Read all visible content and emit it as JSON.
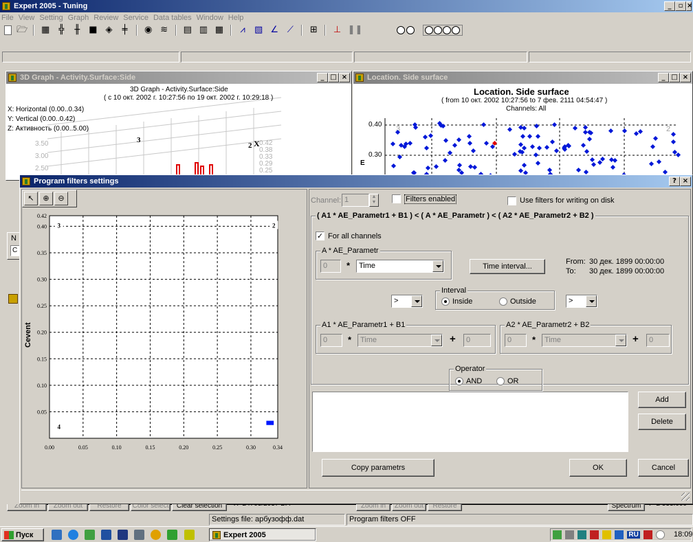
{
  "app": {
    "title": "Expert 2005 - Tuning",
    "menu": [
      "File",
      "View",
      "Setting",
      "Graph",
      "Review",
      "Service",
      "Data tables",
      "Window",
      "Help"
    ],
    "toolbar_circles_small": 2,
    "toolbar_circles_big": 4
  },
  "graph3d": {
    "title": "3D Graph - Activity.Surface:Side",
    "chart_title": "3D Graph - Activity.Surface:Side",
    "period": "( с 10 окт. 2002 г. 10:27:56  по 19 окт. 2002 г.  10:29:18 )",
    "axes": [
      "X: Horizontal (0.00..0.34)",
      "Y: Vertical (0.00..0.42)",
      "Z: Активность (0.00..5.00)"
    ],
    "ticks": [
      "3.50",
      "3.00",
      "2.50"
    ],
    "labels": [
      "3",
      "2",
      "X"
    ],
    "right_ticks": [
      "0.42",
      "0.38",
      "0.33",
      "0.29",
      "0.25"
    ],
    "bottom_left_tab": "N",
    "bottom_left_tab2": "C"
  },
  "location": {
    "title": "Location. Side surface",
    "chart_title": "Location. Side surface",
    "period": "( from 10 окт. 2002  10:27:56  to  7 фев. 2111  04:54:47 )",
    "channels": "Channels: All",
    "yticks": [
      "0.40",
      "0.30"
    ],
    "marker_labels": [
      "3",
      "2"
    ],
    "ylabel_frag": "E"
  },
  "dialog": {
    "title": "Program filters settings",
    "help_btn": "?",
    "close_btn": "×",
    "channel_label": "Channel:",
    "channel_value": "1",
    "filters_enabled": "Filters enabled",
    "use_filters_disk": "Use filters for writing on disk",
    "formula": "( A1 * AE_Parametr1 + B1 )  <  ( A * AE_Parametr )  <  ( A2 * AE_Parametr2 + B2 )",
    "for_all_channels": "For all channels",
    "a_group": "A * AE_Parametr",
    "a_value": "0",
    "a_param": "Time",
    "time_interval_btn": "Time interval...",
    "from_label": "From:",
    "from_value": "30 дек. 1899  00:00:00",
    "to_label": "To:",
    "to_value": "30 дек. 1899  00:00:00",
    "left_cmp": ">",
    "right_cmp": ">",
    "interval_group": "Interval",
    "inside": "Inside",
    "outside": "Outside",
    "a1_group": "A1 * AE_Parametr1 + B1",
    "a1_value": "0",
    "a1_param": "Time",
    "b1_value": "0",
    "a2_group": "A2 * AE_Parametr2 + B2",
    "a2_value": "0",
    "a2_param": "Time",
    "b2_value": "0",
    "operator_group": "Operator",
    "and": "AND",
    "or": "OR",
    "add_btn": "Add",
    "delete_btn": "Delete",
    "copy_btn": "Copy parametrs",
    "ok_btn": "OK",
    "cancel_btn": "Cancel",
    "star": "*",
    "plus": "+"
  },
  "chart_data": {
    "type": "scatter",
    "title": "",
    "xlabel": "",
    "ylabel": "Cevent",
    "x_ticks": [
      "0.00",
      "0.05",
      "0.10",
      "0.15",
      "0.20",
      "0.25",
      "0.30",
      "0.34"
    ],
    "y_ticks": [
      "0.42",
      "0.40",
      "0.35",
      "0.30",
      "0.25",
      "0.20",
      "0.15",
      "0.10",
      "0.05"
    ],
    "xlim": [
      0,
      0.34
    ],
    "ylim": [
      0,
      0.42
    ],
    "grid": true,
    "corner_labels": [
      {
        "text": "3",
        "x": 0.01,
        "y": 0.4
      },
      {
        "text": "2",
        "x": 0.33,
        "y": 0.4
      },
      {
        "text": "4",
        "x": 0.01,
        "y": 0.02
      }
    ],
    "selection_rect": {
      "x0": 0.323,
      "x1": 0.334,
      "y0": 0.025,
      "y1": 0.033
    }
  },
  "bottom": {
    "left_buttons": [
      "Zoom in",
      "Zoom out",
      "Restore",
      "Color select",
      "Clear selection"
    ],
    "left_coord": "X=24703/2037 Б:4",
    "mid_buttons": [
      "Zoom in",
      "Zoom out",
      "Restore"
    ],
    "spectrum_btn": "Spectrum",
    "right_coord": "Y=2 533.000"
  },
  "statusbar": {
    "settings_file": "Settings file: арбузофф.dat",
    "filters": "Program filters OFF"
  },
  "taskbar": {
    "start": "Пуск",
    "task": "Expert 2005",
    "lang": "RU",
    "clock": "18:09"
  }
}
